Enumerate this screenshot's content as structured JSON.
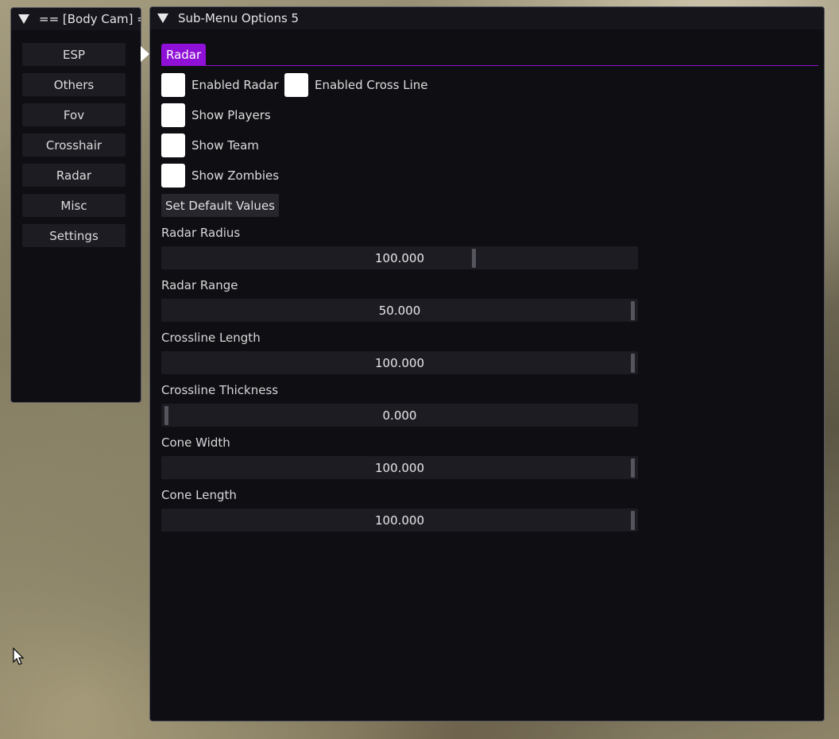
{
  "left_window": {
    "title": "== [Body Cam] ==",
    "nav": [
      "ESP",
      "Others",
      "Fov",
      "Crosshair",
      "Radar",
      "Misc",
      "Settings"
    ]
  },
  "right_window": {
    "title": "Sub-Menu Options 5",
    "active_tab": "Radar",
    "checkboxes": [
      {
        "label": "Enabled Radar",
        "checked": false
      },
      {
        "label": "Enabled Cross Line",
        "checked": false
      },
      {
        "label": "Show Players",
        "checked": false
      },
      {
        "label": "Show Team",
        "checked": false
      },
      {
        "label": "Show Zombies",
        "checked": false
      }
    ],
    "default_button": "Set Default Values",
    "sliders": [
      {
        "label": "Radar Radius",
        "value": "100.000",
        "fraction": 0.66
      },
      {
        "label": "Radar Range",
        "value": "50.000",
        "fraction": 1.0
      },
      {
        "label": "Crossline Length",
        "value": "100.000",
        "fraction": 1.0
      },
      {
        "label": "Crossline Thickness",
        "value": "0.000",
        "fraction": 0.0
      },
      {
        "label": "Cone Width",
        "value": "100.000",
        "fraction": 1.0
      },
      {
        "label": "Cone Length",
        "value": "100.000",
        "fraction": 1.0
      }
    ]
  },
  "colors": {
    "accent": "#8f10d6",
    "window_bg": "#0f0e13",
    "frame_bg": "#1d1c23"
  },
  "icons": [
    "collapse-triangle-icon",
    "tab-arrow-icon",
    "mouse-cursor-icon"
  ]
}
